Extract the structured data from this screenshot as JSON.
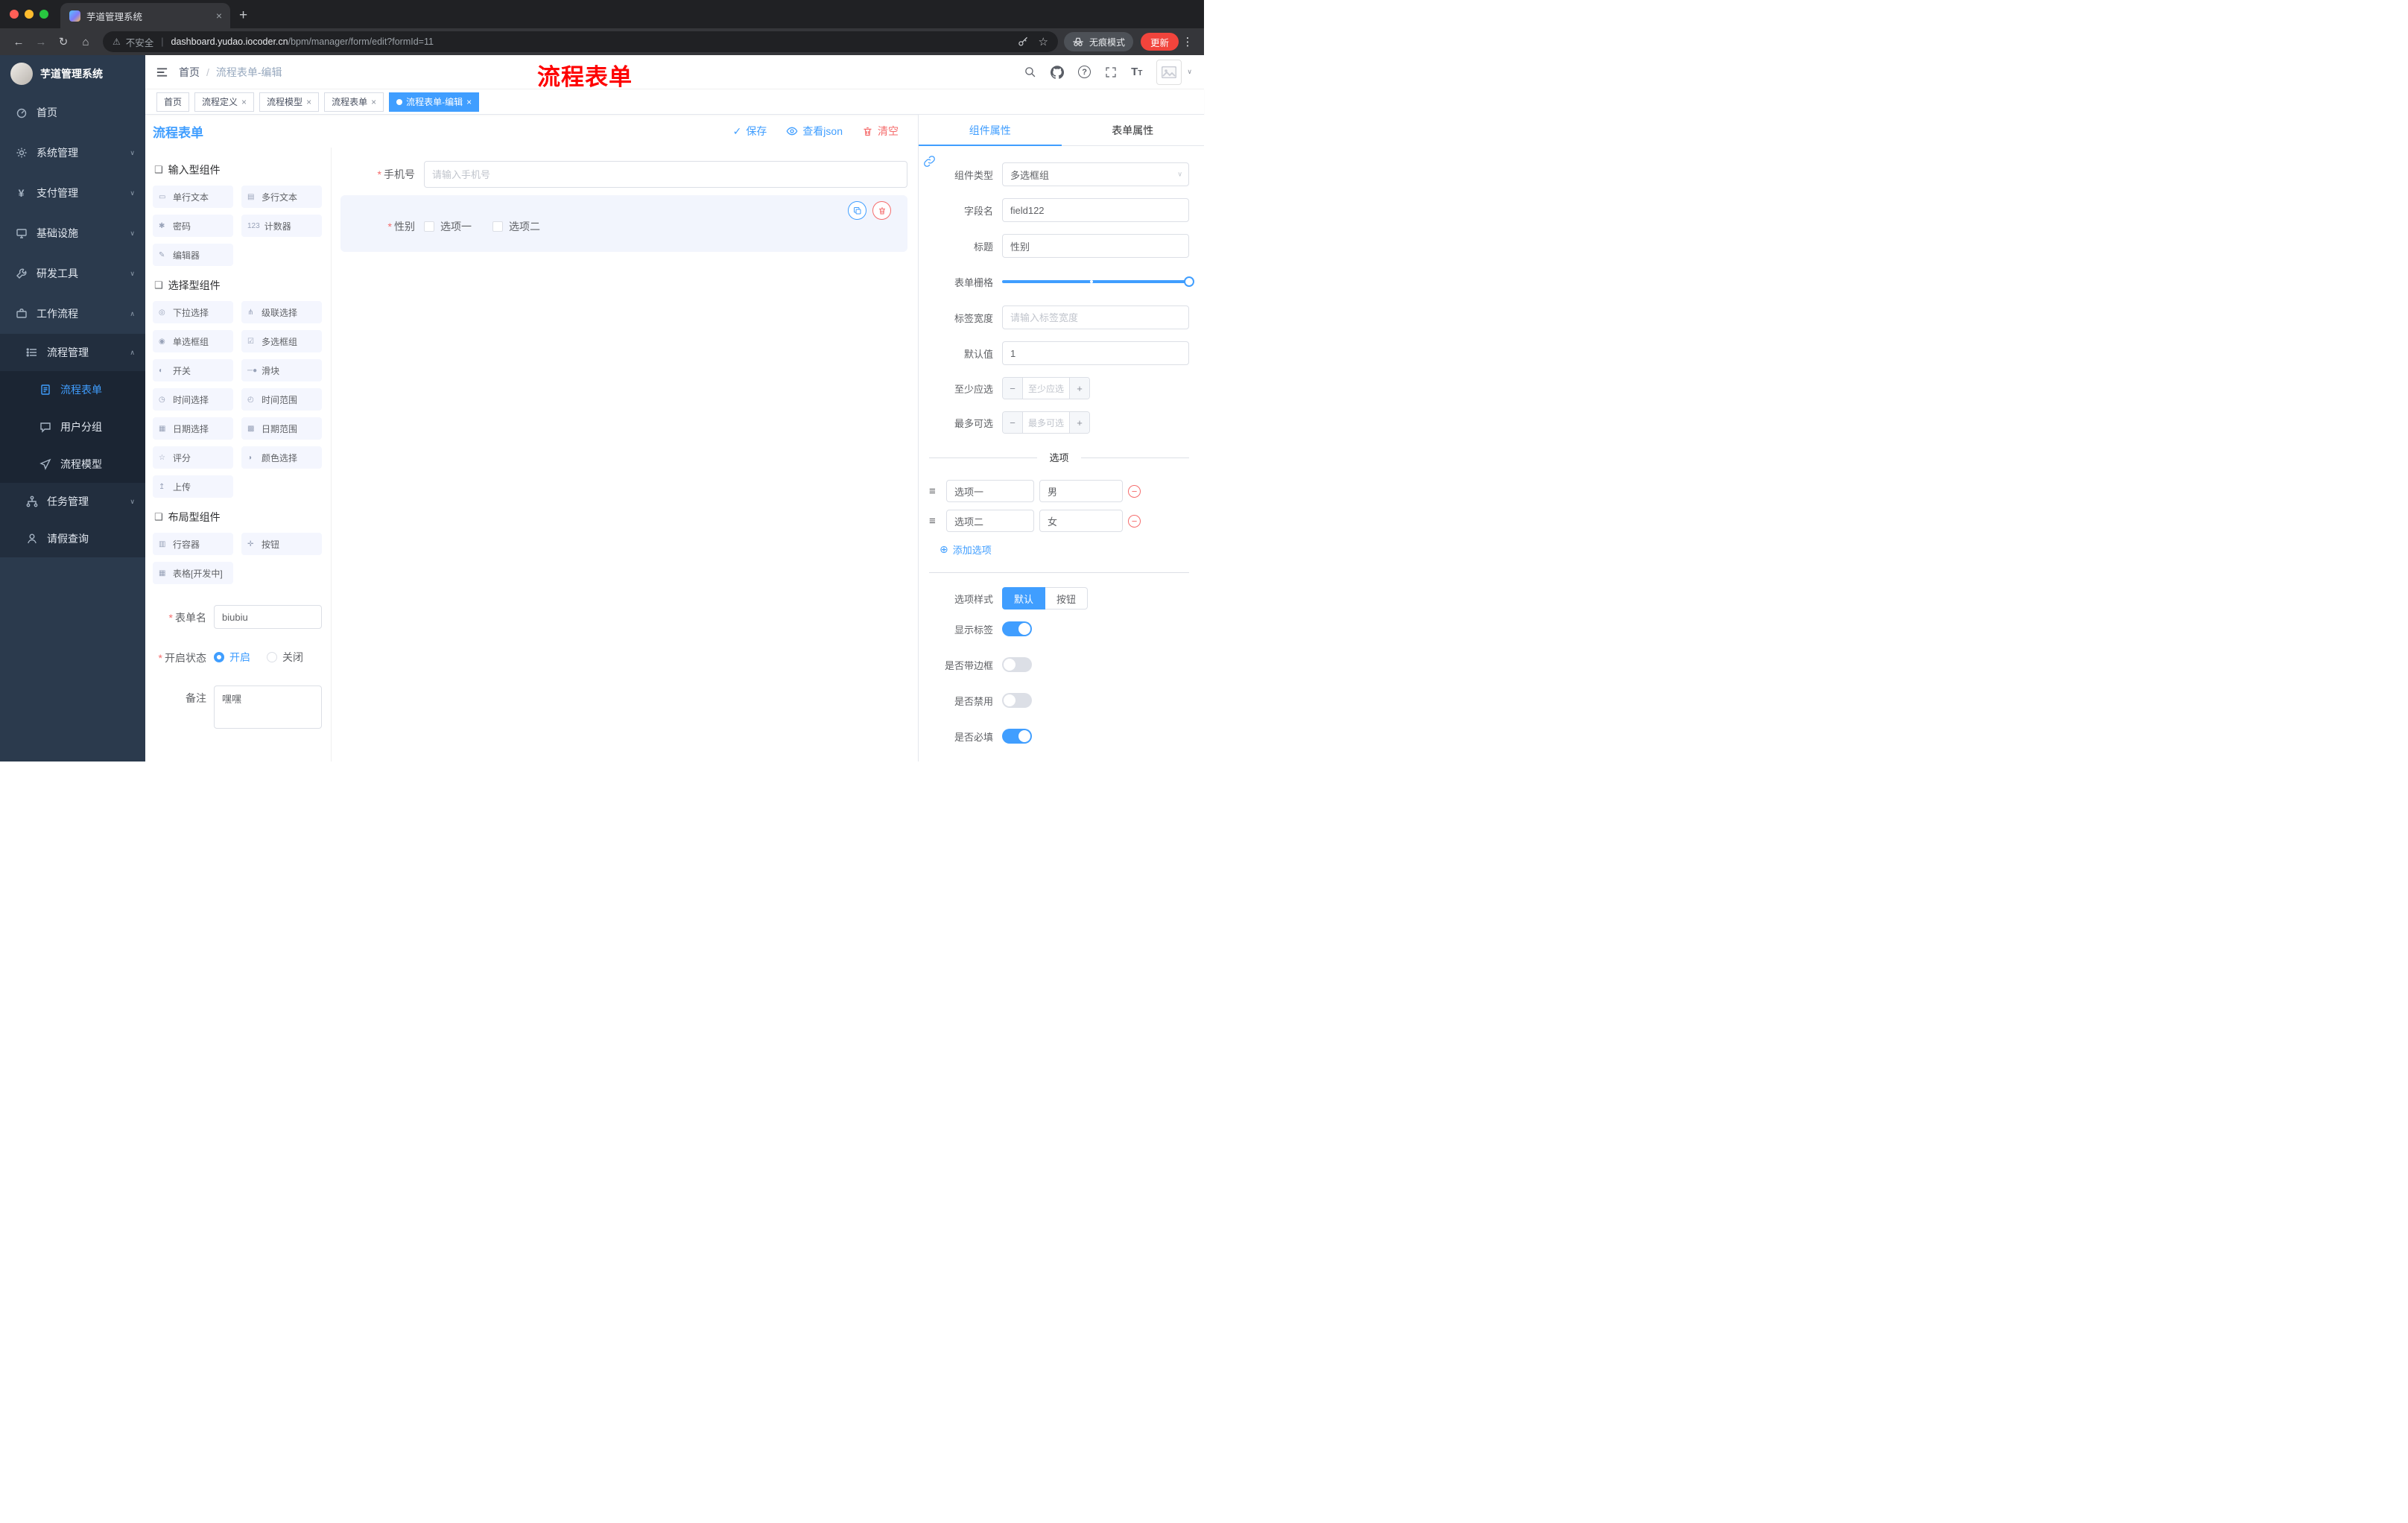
{
  "colors": {
    "accent": "#409EFF",
    "danger": "#F56C6C",
    "annotation_red": "#FE0000"
  },
  "browser": {
    "tab_title": "芋道管理系统",
    "security_label": "不安全",
    "url_host": "dashboard.yudao.iocoder.cn",
    "url_path": "/bpm/manager/form/edit?formId=11",
    "incognito_label": "无痕模式",
    "update_label": "更新"
  },
  "sidebar": {
    "title": "芋道管理系统",
    "menu": [
      "首页",
      "系统管理",
      "支付管理",
      "基础设施",
      "研发工具",
      "工作流程"
    ],
    "process_mgmt": "流程管理",
    "process_children": [
      "流程表单",
      "用户分组",
      "流程模型"
    ],
    "task_mgmt": "任务管理",
    "leave_query": "请假查询"
  },
  "header": {
    "breadcrumb_home": "首页",
    "breadcrumb_current": "流程表单-编辑",
    "overlay_title": "流程表单"
  },
  "tags": [
    "首页",
    "流程定义",
    "流程模型",
    "流程表单",
    "流程表单-编辑"
  ],
  "designer": {
    "title": "流程表单",
    "actions": {
      "save": "保存",
      "view_json": "查看json",
      "clear": "清空"
    },
    "palette": {
      "sections": [
        {
          "title": "输入型组件",
          "icon": "❑",
          "items": [
            {
              "icon": "▭",
              "label": "单行文本"
            },
            {
              "icon": "▤",
              "label": "多行文本"
            },
            {
              "icon": "✱",
              "label": "密码"
            },
            {
              "icon": "123",
              "label": "计数器"
            },
            {
              "icon": "✎",
              "label": "编辑器"
            }
          ]
        },
        {
          "title": "选择型组件",
          "icon": "❑",
          "items": [
            {
              "icon": "◎",
              "label": "下拉选择"
            },
            {
              "icon": "⋔",
              "label": "级联选择"
            },
            {
              "icon": "◉",
              "label": "单选框组"
            },
            {
              "icon": "☑",
              "label": "多选框组"
            },
            {
              "icon": "◐",
              "label": "开关"
            },
            {
              "icon": "─●",
              "label": "滑块"
            },
            {
              "icon": "◷",
              "label": "时间选择"
            },
            {
              "icon": "◴",
              "label": "时间范围"
            },
            {
              "icon": "▦",
              "label": "日期选择"
            },
            {
              "icon": "▩",
              "label": "日期范围"
            },
            {
              "icon": "☆",
              "label": "评分"
            },
            {
              "icon": "◑",
              "label": "颜色选择"
            },
            {
              "icon": "↥",
              "label": "上传"
            }
          ]
        },
        {
          "title": "布局型组件",
          "icon": "❑",
          "items": [
            {
              "icon": "▥",
              "label": "行容器"
            },
            {
              "icon": "✛",
              "label": "按钮"
            },
            {
              "icon": "▦",
              "label": "表格[开发中]"
            }
          ]
        }
      ]
    },
    "meta": {
      "name_label": "表单名",
      "name_value": "biubiu",
      "status_label": "开启状态",
      "status_on": "开启",
      "status_off": "关闭",
      "remark_label": "备注",
      "remark_value": "嘿嘿"
    },
    "canvas": {
      "phone": {
        "label": "手机号",
        "placeholder": "请输入手机号"
      },
      "gender": {
        "label": "性别",
        "options": [
          "选项一",
          "选项二"
        ]
      }
    }
  },
  "props": {
    "tabs": [
      "组件属性",
      "表单属性"
    ],
    "fields": {
      "type_label": "组件类型",
      "type_value": "多选框组",
      "field_label": "字段名",
      "field_value": "field122",
      "title_label": "标题",
      "title_value": "性别",
      "grid_label": "表单栅格",
      "label_width_label": "标签宽度",
      "label_width_placeholder": "请输入标签宽度",
      "default_label": "默认值",
      "default_value": "1",
      "min_label": "至少应选",
      "min_placeholder": "至少应选",
      "max_label": "最多可选",
      "max_placeholder": "最多可选"
    },
    "options": {
      "divider_label": "选项",
      "rows": [
        {
          "label": "选项一",
          "value": "男"
        },
        {
          "label": "选项二",
          "value": "女"
        }
      ],
      "add_label": "添加选项"
    },
    "style": {
      "label": "选项样式",
      "options": [
        "默认",
        "按钮"
      ]
    },
    "switches": [
      {
        "label": "显示标签",
        "on": true
      },
      {
        "label": "是否带边框",
        "on": false
      },
      {
        "label": "是否禁用",
        "on": false
      },
      {
        "label": "是否必填",
        "on": true
      }
    ]
  }
}
